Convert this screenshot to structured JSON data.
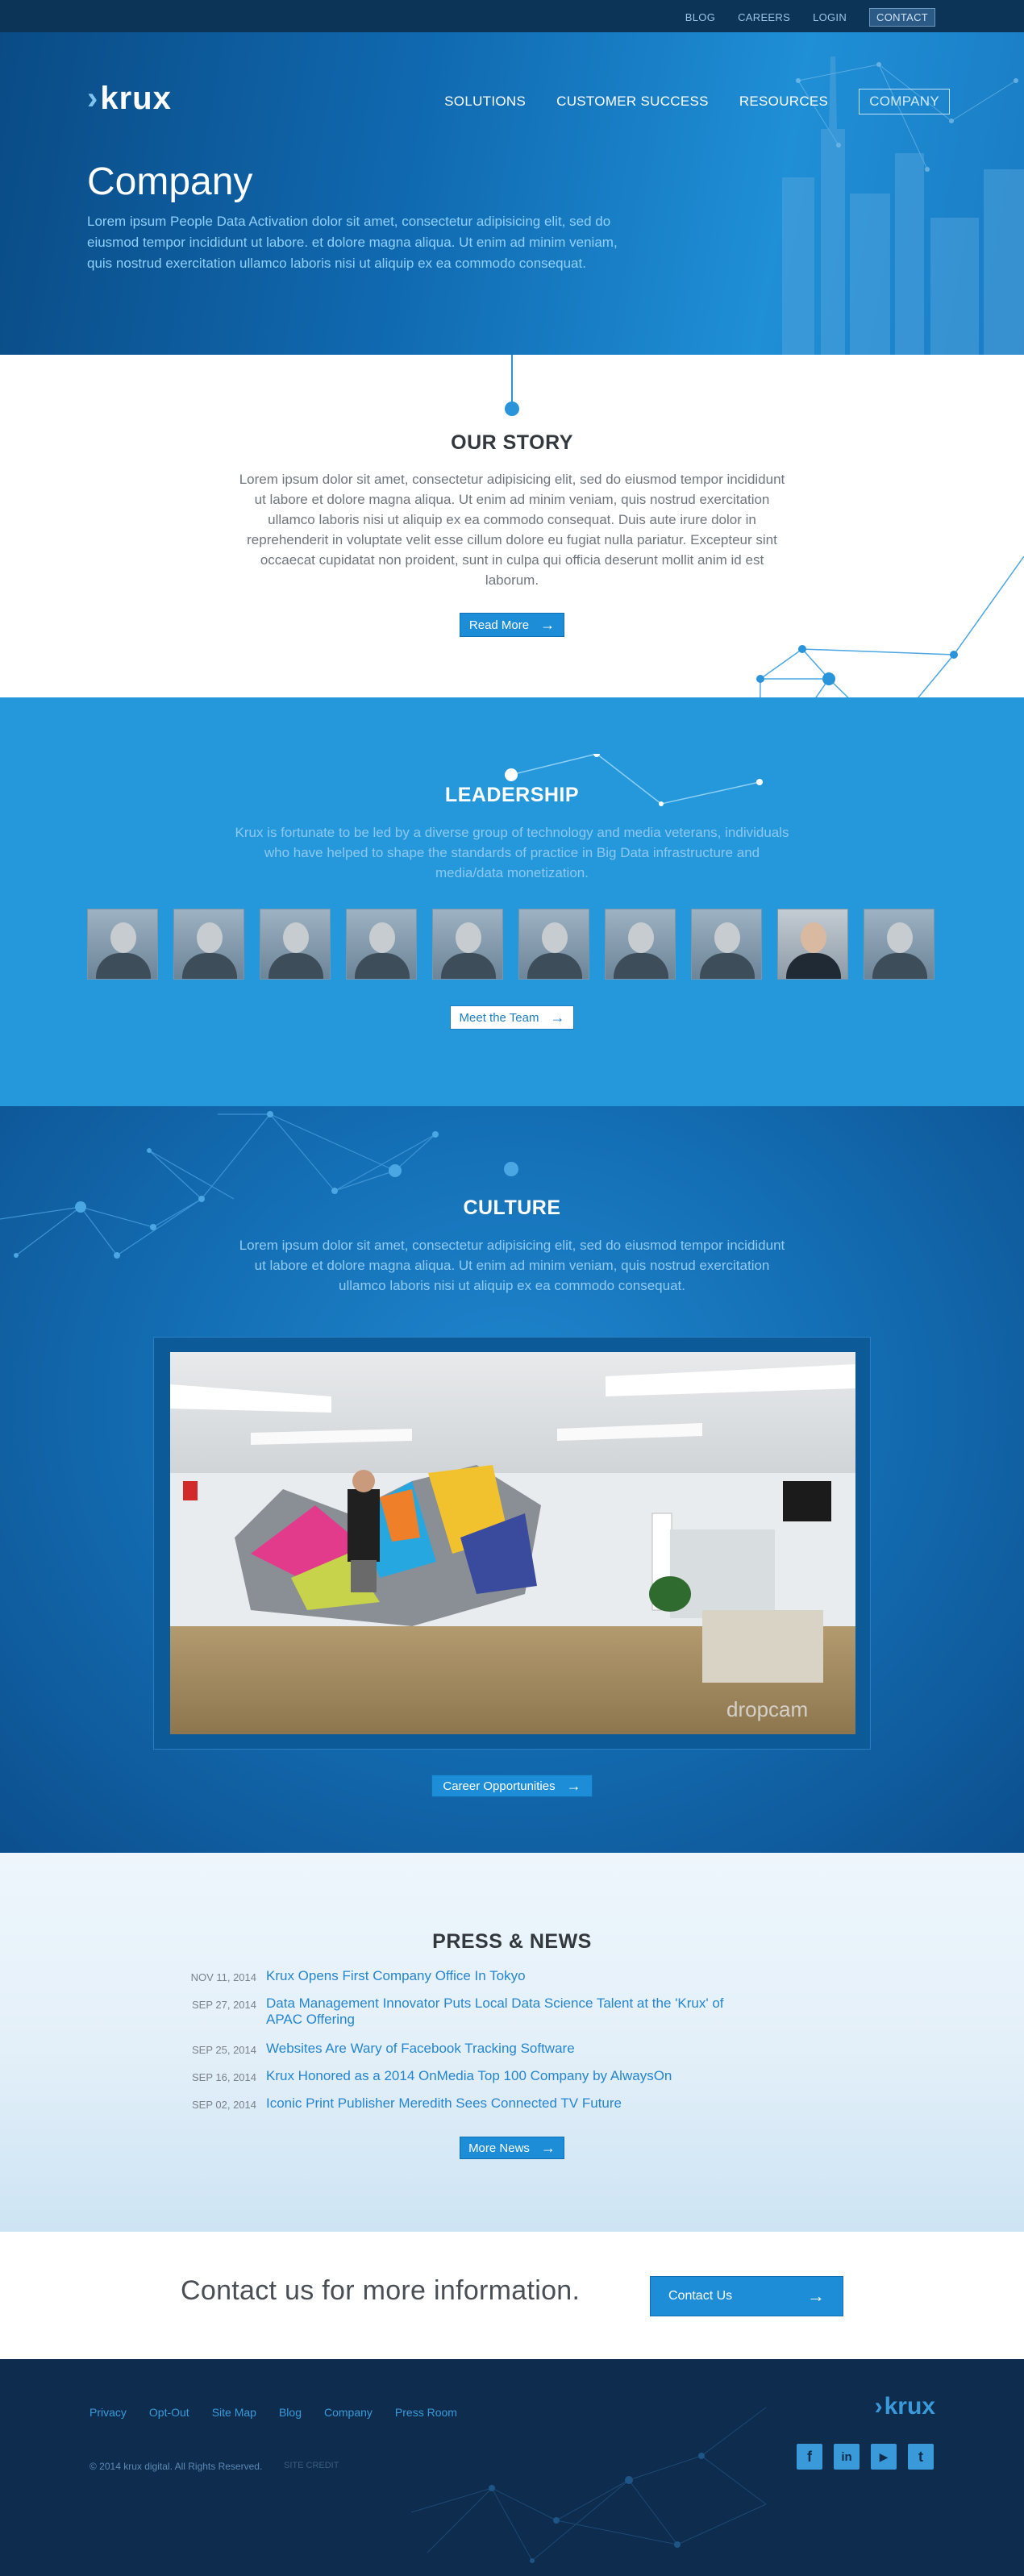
{
  "topbar": {
    "links": [
      "BLOG",
      "CAREERS",
      "LOGIN",
      "CONTACT"
    ]
  },
  "brand": {
    "name": "krux",
    "mark": "›"
  },
  "nav": {
    "items": [
      "SOLUTIONS",
      "CUSTOMER SUCCESS",
      "RESOURCES",
      "COMPANY"
    ],
    "active": "COMPANY"
  },
  "hero": {
    "title": "Company",
    "text": "Lorem ipsum People Data Activation dolor sit amet, consectetur adipisicing elit, sed do eiusmod tempor incididunt ut labore. et dolore magna aliqua. Ut enim ad minim veniam, quis nostrud exercitation ullamco laboris nisi ut aliquip ex ea commodo consequat."
  },
  "story": {
    "title": "OUR STORY",
    "text": "Lorem ipsum dolor sit amet, consectetur adipisicing elit, sed do eiusmod tempor incididunt ut labore et dolore magna aliqua. Ut enim ad minim veniam, quis nostrud exercitation ullamco laboris nisi ut aliquip ex ea commodo consequat. Duis aute irure dolor in reprehenderit in voluptate velit esse cillum dolore eu fugiat nulla pariatur. Excepteur sint occaecat cupidatat non proident, sunt in culpa qui officia deserunt mollit anim id est laborum.",
    "button": "Read More"
  },
  "leadership": {
    "title": "LEADERSHIP",
    "text": "Krux is fortunate to be led by a diverse group of technology and media veterans, individuals who have helped to shape the standards of practice in Big Data infrastructure and media/data monetization.",
    "button": "Meet the Team",
    "portrait_count": 10
  },
  "culture": {
    "title": "CULTURE",
    "text": "Lorem ipsum dolor sit amet, consectetur adipisicing elit, sed do eiusmod tempor incididunt ut labore et dolore magna aliqua. Ut enim ad minim veniam, quis nostrud exercitation ullamco laboris nisi ut aliquip ex ea commodo consequat.",
    "video_watermark": "dropcam",
    "button": "Career Opportunities"
  },
  "press": {
    "title": "PRESS & NEWS",
    "items": [
      {
        "date": "NOV 11, 2014",
        "title": "Krux Opens First Company Office In Tokyo"
      },
      {
        "date": "SEP 27, 2014",
        "title": "Data Management Innovator Puts Local Data Science Talent at the 'Krux' of APAC Offering"
      },
      {
        "date": "SEP 25, 2014",
        "title": "Websites Are Wary of Facebook Tracking Software"
      },
      {
        "date": "SEP 16, 2014",
        "title": "Krux Honored as a 2014 OnMedia Top 100 Company by AlwaysOn"
      },
      {
        "date": "SEP 02, 2014",
        "title": "Iconic Print Publisher Meredith Sees Connected TV Future"
      }
    ],
    "button": "More News"
  },
  "contact": {
    "text": "Contact us for more information.",
    "button": "Contact Us"
  },
  "footer": {
    "links": [
      "Privacy",
      "Opt-Out",
      "Site Map",
      "Blog",
      "Company",
      "Press Room"
    ],
    "copyright": "© 2014 krux digital. All Rights Reserved.",
    "credit": "SITE CREDIT",
    "social": [
      "f",
      "in",
      "▶",
      "t"
    ]
  },
  "colors": {
    "accent": "#2598db",
    "dark": "#0e2c4e",
    "hero_dark": "#0a4b85"
  }
}
